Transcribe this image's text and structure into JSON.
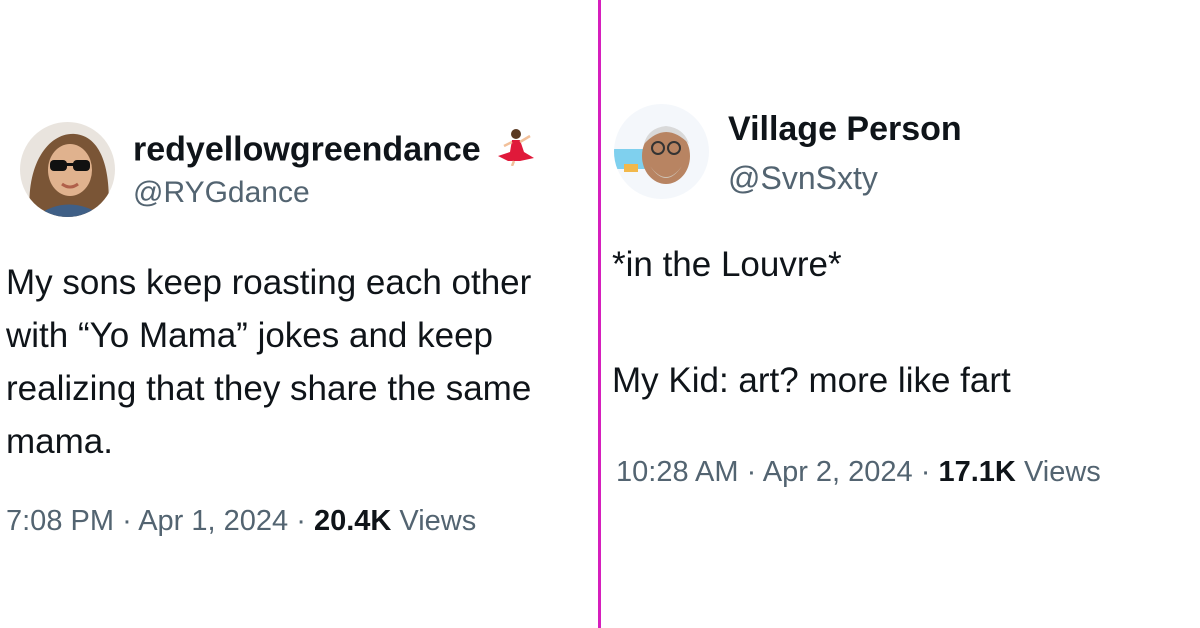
{
  "tweets": [
    {
      "name": "redyellowgreendance",
      "name_emoji": "dancer-emoji",
      "handle": "@RYGdance",
      "text": "My sons keep roasting each other with “Yo Mama” jokes and keep realizing that they share the same mama.",
      "time": "7:08 PM",
      "date": "Apr 1, 2024",
      "views_count": "20.4K",
      "views_label": "Views",
      "separator": "·"
    },
    {
      "name": "Village Person",
      "handle": "@SvnSxty",
      "text_line1": "*in the Louvre*",
      "text_line2": "My Kid: art? more like fart",
      "time": "10:28 AM",
      "date": "Apr 2, 2024",
      "views_count": "17.1K",
      "views_label": "Views",
      "separator": "·"
    }
  ],
  "colors": {
    "divider": "#d61fbd",
    "text": "#0f1419",
    "secondary": "#536471"
  }
}
